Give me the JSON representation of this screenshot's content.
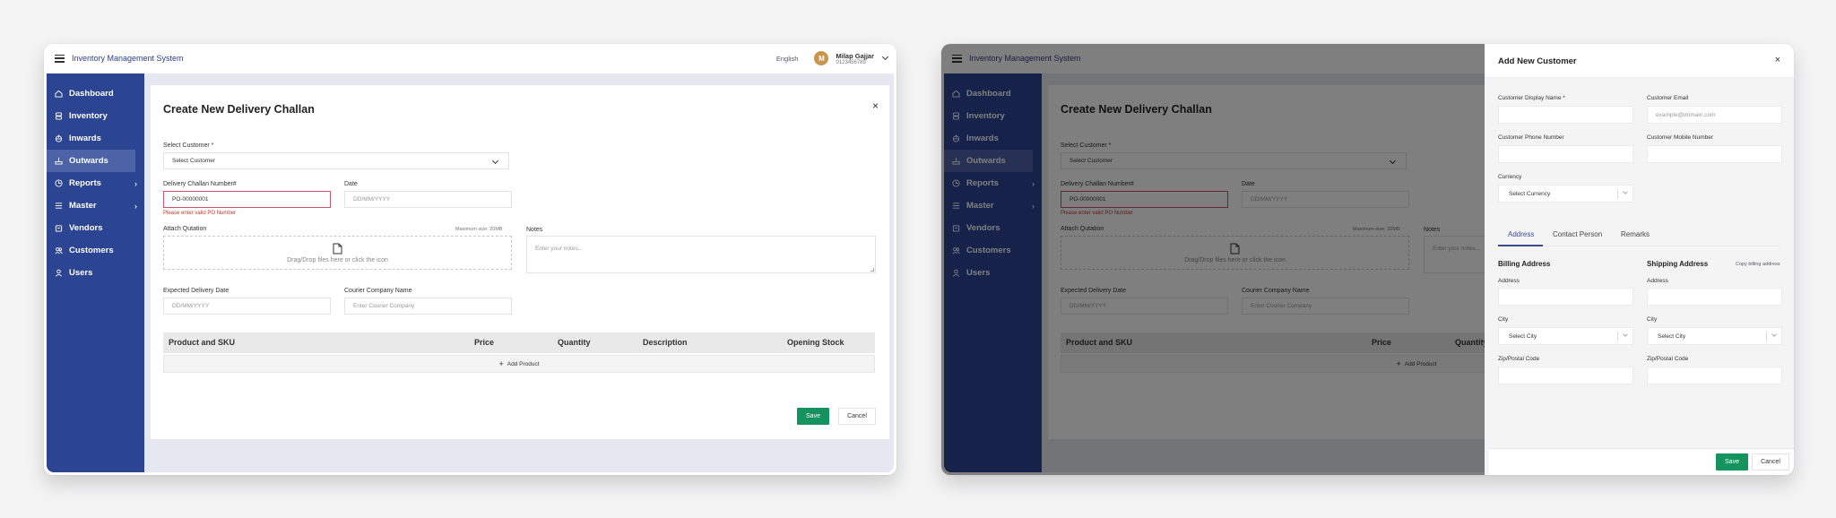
{
  "app": {
    "title": "Inventory Management System",
    "language": "English",
    "user": {
      "initial": "M",
      "name": "Milap Gajjar",
      "phone": "0123456789"
    }
  },
  "sidebar": {
    "items": [
      {
        "label": "Dashboard",
        "icon": "home-icon",
        "active": false,
        "has_submenu": false
      },
      {
        "label": "Inventory",
        "icon": "database-icon",
        "active": false,
        "has_submenu": false
      },
      {
        "label": "Inwards",
        "icon": "inwards-icon",
        "active": false,
        "has_submenu": false
      },
      {
        "label": "Outwards",
        "icon": "outwards-icon",
        "active": true,
        "has_submenu": false
      },
      {
        "label": "Reports",
        "icon": "clock-chart-icon",
        "active": false,
        "has_submenu": true
      },
      {
        "label": "Master",
        "icon": "list-icon",
        "active": false,
        "has_submenu": true
      },
      {
        "label": "Vendors",
        "icon": "store-icon",
        "active": false,
        "has_submenu": false
      },
      {
        "label": "Customers",
        "icon": "users-icon",
        "active": false,
        "has_submenu": false
      },
      {
        "label": "Users",
        "icon": "user-icon",
        "active": false,
        "has_submenu": false
      }
    ],
    "submenu_arrow": "›"
  },
  "challan_form": {
    "title": "Create New Delivery Challan",
    "close": "×",
    "customer": {
      "label": "Select Customer *",
      "placeholder": "Select Customer"
    },
    "challan_number": {
      "label": "Delivery Challan Number#",
      "value": "PO-00000001",
      "error": "Please enter valid PO Number"
    },
    "date": {
      "label": "Date",
      "placeholder": "DD/MM/YYYY"
    },
    "attach": {
      "label": "Attach Qutation",
      "max_size": "Maximum size: 20MB",
      "drop_text": "Drag/Drop files here or click the icon"
    },
    "notes": {
      "label": "Notes",
      "placeholder": "Enter your notes..."
    },
    "expected_date": {
      "label": "Expected Delivery Date",
      "placeholder": "DD/MM/YYYY"
    },
    "courier": {
      "label": "Courier Company Name",
      "placeholder": "Enter Courier Company"
    },
    "table": {
      "columns": [
        "Product and SKU",
        "Price",
        "Quantity",
        "Description",
        "Opening Stock"
      ],
      "add_product": "Add Product",
      "plus": "+"
    },
    "save": "Save",
    "cancel": "Cancel"
  },
  "customer_drawer": {
    "title": "Add New Customer",
    "close": "×",
    "display_name": {
      "label": "Customer Display Name *",
      "value": ""
    },
    "email": {
      "label": "Customer Email",
      "placeholder": "example@domain.com"
    },
    "phone": {
      "label": "Customer Phone Number",
      "value": ""
    },
    "mobile": {
      "label": "Customer Mobile Number",
      "value": ""
    },
    "currency": {
      "label": "Currency",
      "placeholder": "Select Currency"
    },
    "tabs": [
      {
        "label": "Address",
        "active": true
      },
      {
        "label": "Contact Person",
        "active": false
      },
      {
        "label": "Remarks",
        "active": false
      }
    ],
    "billing": {
      "heading": "Billing Address",
      "address_label": "Address",
      "city_label": "City",
      "city_placeholder": "Select City",
      "zip_label": "Zip/Postal Code"
    },
    "shipping": {
      "heading": "Shipping Address",
      "copy_link": "Copy billing address",
      "address_label": "Address",
      "city_label": "City",
      "city_placeholder": "Select City",
      "zip_label": "Zip/Postal Code"
    },
    "save": "Save",
    "cancel": "Cancel"
  },
  "colors": {
    "sidebar": "#2c4592",
    "sidebar_active": "#4c63a6",
    "primary_text": "#2c3e87",
    "save_button": "#15935e",
    "error": "#c7546b",
    "avatar": "#c9954a"
  }
}
